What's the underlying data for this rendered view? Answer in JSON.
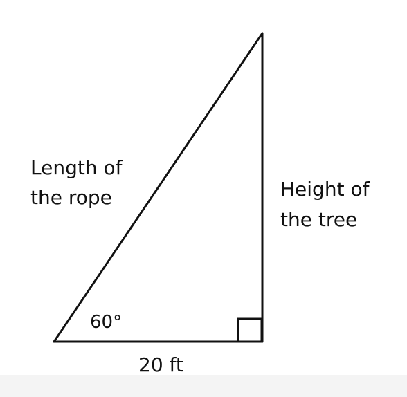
{
  "diagram": {
    "hypotenuse_label": [
      "Length of",
      "the rope"
    ],
    "vertical_side_label": [
      "Height of",
      "the tree"
    ],
    "base_label": "20 ft",
    "angle_label": "60°",
    "right_angle_marker": "right-angle",
    "colors": {
      "stroke": "#111111",
      "background": "#ffffff",
      "footer": "#f4f4f4"
    }
  }
}
